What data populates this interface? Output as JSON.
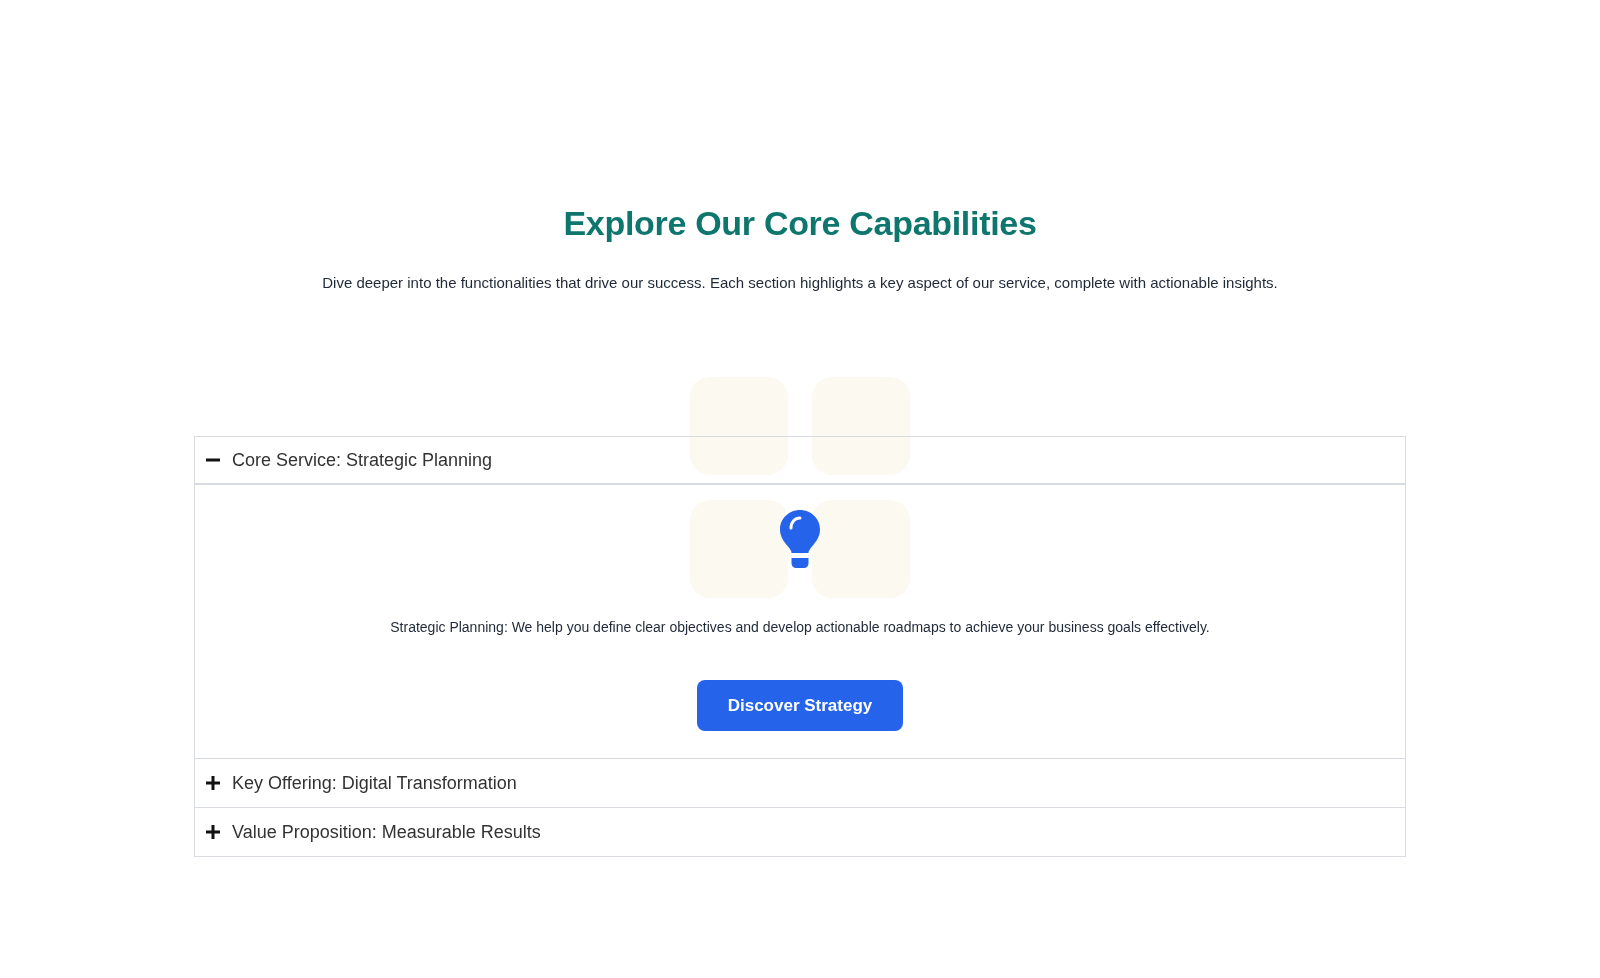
{
  "heading": "Explore Our Core Capabilities",
  "subtitle": "Dive deeper into the functionalities that drive our success. Each section highlights a key aspect of our service, complete with actionable insights.",
  "accordion": [
    {
      "title": "Core Service: Strategic Planning",
      "expanded": true,
      "body": {
        "text": "Strategic Planning: We help you define clear objectives and develop actionable roadmaps to achieve your business goals effectively.",
        "button": "Discover Strategy"
      }
    },
    {
      "title": "Key Offering: Digital Transformation",
      "expanded": false
    },
    {
      "title": "Value Proposition: Measurable Results",
      "expanded": false
    }
  ]
}
